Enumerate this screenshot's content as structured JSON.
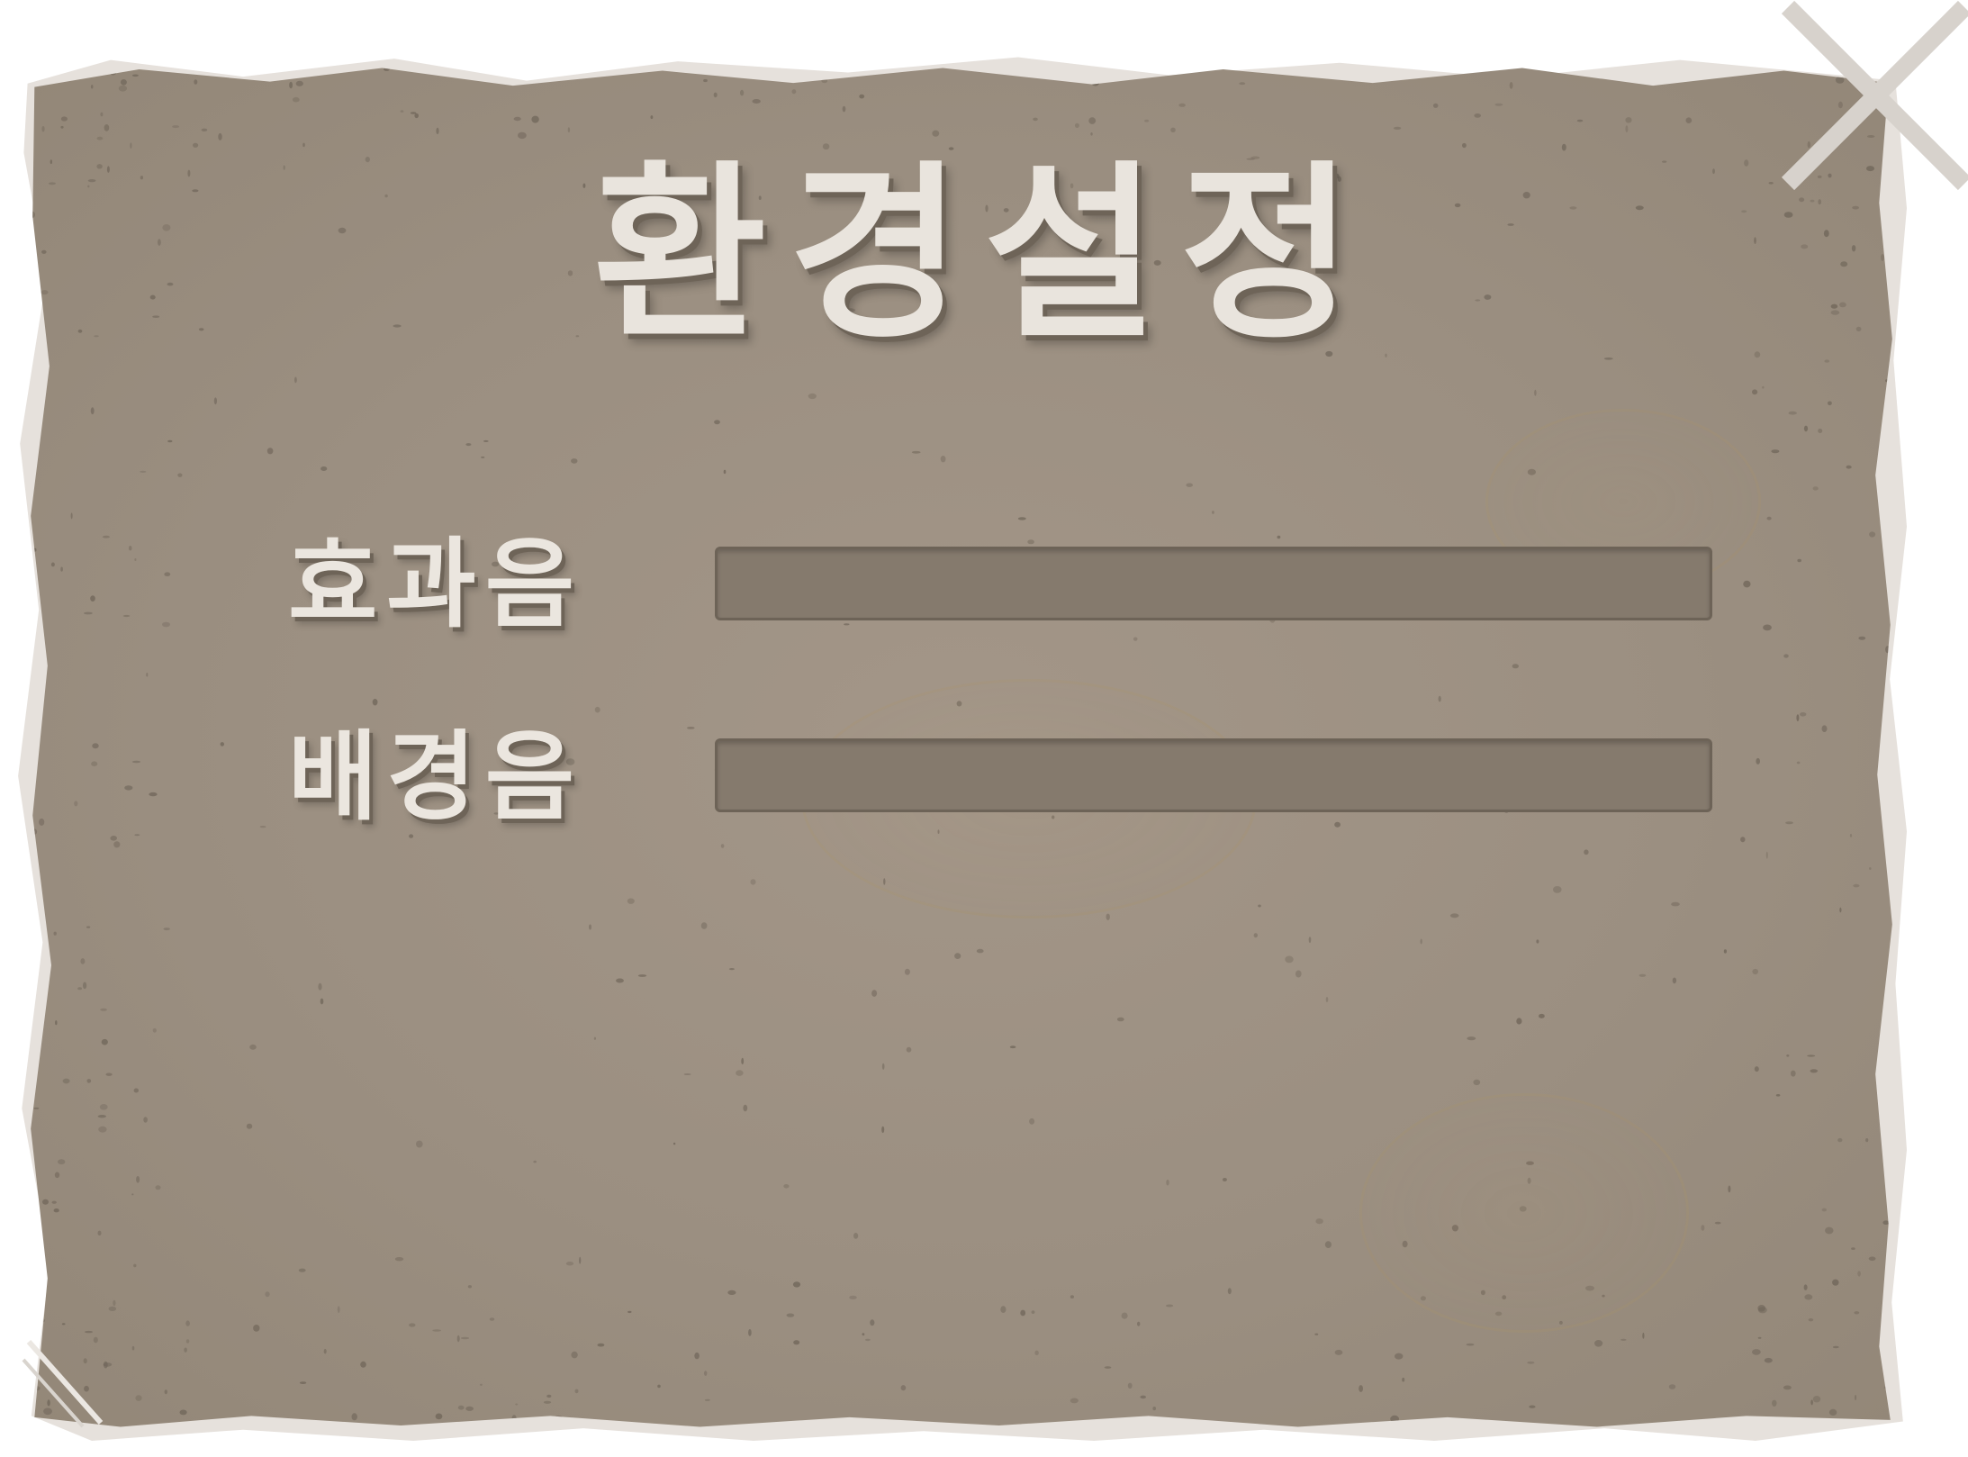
{
  "dialog": {
    "title": "환경설정"
  },
  "settings": [
    {
      "label": "효과음",
      "level": 0
    },
    {
      "label": "배경음",
      "level": 0
    }
  ],
  "colors": {
    "panel": "#9d9183",
    "title_text": "#e9e4dd",
    "text_shadow": "#6e6458",
    "slider_track": "#857a6d",
    "close_icon": "#d7d2cc"
  },
  "icons": {
    "close": "close-icon"
  }
}
